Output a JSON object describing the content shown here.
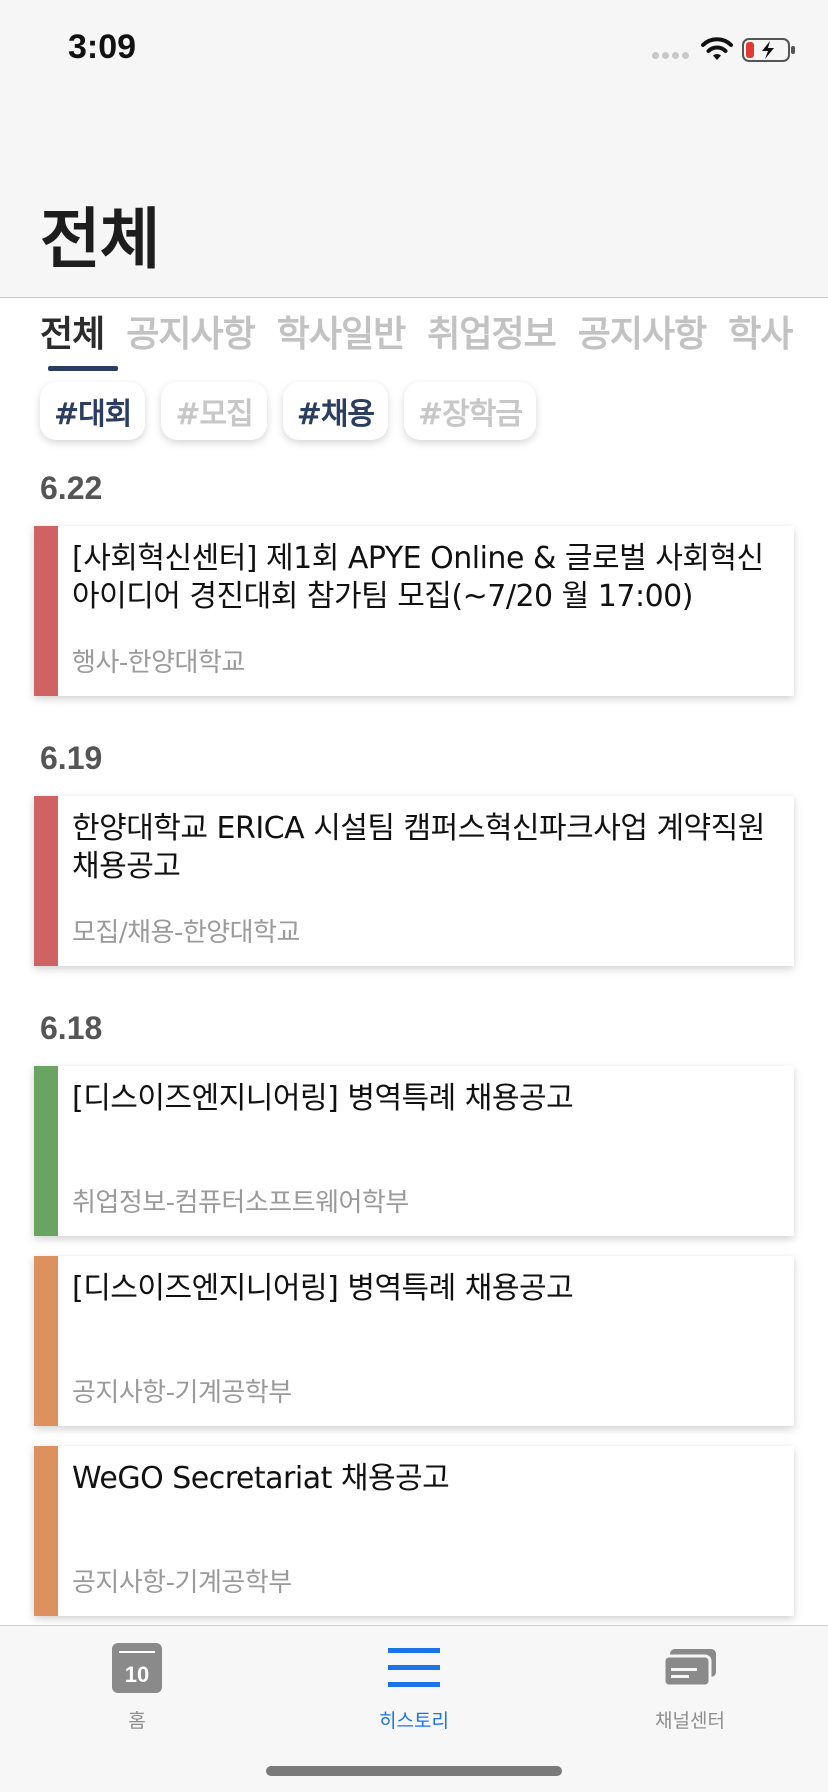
{
  "status_bar": {
    "time": "3:09"
  },
  "page": {
    "title": "전체"
  },
  "tabs": [
    {
      "label": "전체",
      "active": true
    },
    {
      "label": "공지사항",
      "active": false
    },
    {
      "label": "학사일반",
      "active": false
    },
    {
      "label": "취업정보",
      "active": false
    },
    {
      "label": "공지사항",
      "active": false
    },
    {
      "label": "학사",
      "active": false
    }
  ],
  "chips": [
    {
      "label": "#대회",
      "selected": true
    },
    {
      "label": "#모집",
      "selected": false
    },
    {
      "label": "#채용",
      "selected": true
    },
    {
      "label": "#장학금",
      "selected": false
    }
  ],
  "groups": [
    {
      "date": "6.22",
      "items": [
        {
          "title": "[사회혁신센터] 제1회 APYE Online & 글로벌 사회혁신아이디어 경진대회 참가팀 모집(~7/20 월 17:00)",
          "source": "행사-한양대학교",
          "color": "#cf6262"
        }
      ]
    },
    {
      "date": "6.19",
      "items": [
        {
          "title": "한양대학교 ERICA 시설팀 캠퍼스혁신파크사업 계약직원 채용공고",
          "source": "모집/채용-한양대학교",
          "color": "#cf6262"
        }
      ]
    },
    {
      "date": "6.18",
      "items": [
        {
          "title": "[디스이즈엔지니어링] 병역특례 채용공고",
          "source": "취업정보-컴퓨터소프트웨어학부",
          "color": "#6aa462"
        },
        {
          "title": "[디스이즈엔지니어링] 병역특례 채용공고",
          "source": "공지사항-기계공학부",
          "color": "#dc915f"
        },
        {
          "title": "WeGO Secretariat 채용공고",
          "source": "공지사항-기계공학부",
          "color": "#dc915f"
        }
      ]
    }
  ],
  "tabbar": {
    "home": {
      "label": "홈",
      "calendar_day": "10",
      "icon": "calendar-icon"
    },
    "history": {
      "label": "히스토리",
      "icon": "list-icon",
      "color": "#1a73e8"
    },
    "channels": {
      "label": "채널센터",
      "icon": "cards-icon"
    }
  },
  "colors": {
    "accent": "#2c3e5f",
    "active_tab": "#1a73e8"
  }
}
